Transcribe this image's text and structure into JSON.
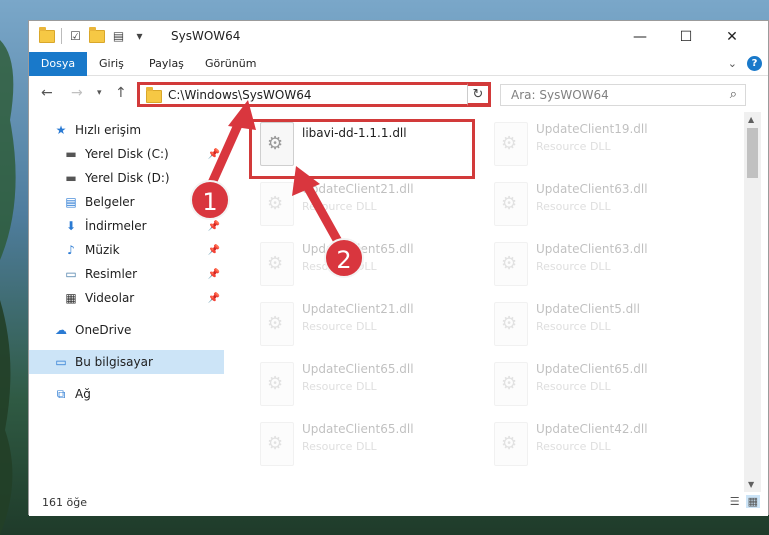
{
  "window": {
    "title": "SysWOW64",
    "controls": {
      "minimize": "—",
      "maximize": "☐",
      "close": "✕"
    }
  },
  "ribbon": {
    "tabs": [
      "Dosya",
      "Giriş",
      "Paylaş",
      "Görünüm"
    ],
    "help": "?"
  },
  "address": {
    "path": "C:\\Windows\\SysWOW64",
    "search_placeholder": "Ara: SysWOW64"
  },
  "sidebar": {
    "quick_access": "Hızlı erişim",
    "items": [
      {
        "label": "Yerel Disk (C:)",
        "icon": "drive-icon",
        "pinned": true
      },
      {
        "label": "Yerel Disk (D:)",
        "icon": "drive-icon",
        "pinned": false
      },
      {
        "label": "Belgeler",
        "icon": "documents-icon",
        "pinned": true
      },
      {
        "label": "İndirmeler",
        "icon": "download-icon",
        "pinned": true
      },
      {
        "label": "Müzik",
        "icon": "music-icon",
        "pinned": true
      },
      {
        "label": "Resimler",
        "icon": "pictures-icon",
        "pinned": true
      },
      {
        "label": "Videolar",
        "icon": "videos-icon",
        "pinned": true
      }
    ],
    "onedrive": "OneDrive",
    "this_pc": "Bu bilgisayar",
    "network": "Ağ"
  },
  "files": {
    "highlighted": {
      "name": "libavi-dd-1.1.1.dll",
      "type": ""
    },
    "items": [
      {
        "name": "UpdateClient19.dll",
        "type": "Resource DLL"
      },
      {
        "name": "UpdateClient21.dll",
        "type": "Resource DLL"
      },
      {
        "name": "UpdateClient63.dll",
        "type": "Resource DLL"
      },
      {
        "name": "UpdateClient65.dll",
        "type": "Resource DLL"
      },
      {
        "name": "UpdateClient63.dll",
        "type": "Resource DLL"
      },
      {
        "name": "UpdateClient21.dll",
        "type": "Resource DLL"
      },
      {
        "name": "UpdateClient5.dll",
        "type": "Resource DLL"
      },
      {
        "name": "UpdateClient65.dll",
        "type": "Resource DLL"
      },
      {
        "name": "UpdateClient65.dll",
        "type": "Resource DLL"
      },
      {
        "name": "UpdateClient65.dll",
        "type": "Resource DLL"
      },
      {
        "name": "UpdateClient42.dll",
        "type": "Resource DLL"
      }
    ]
  },
  "status": {
    "count": "161 öğe"
  },
  "markers": {
    "first": "1",
    "second": "2"
  },
  "colors": {
    "accent": "#1979ca",
    "highlight": "#d23a3a",
    "marker": "#d9363e"
  }
}
